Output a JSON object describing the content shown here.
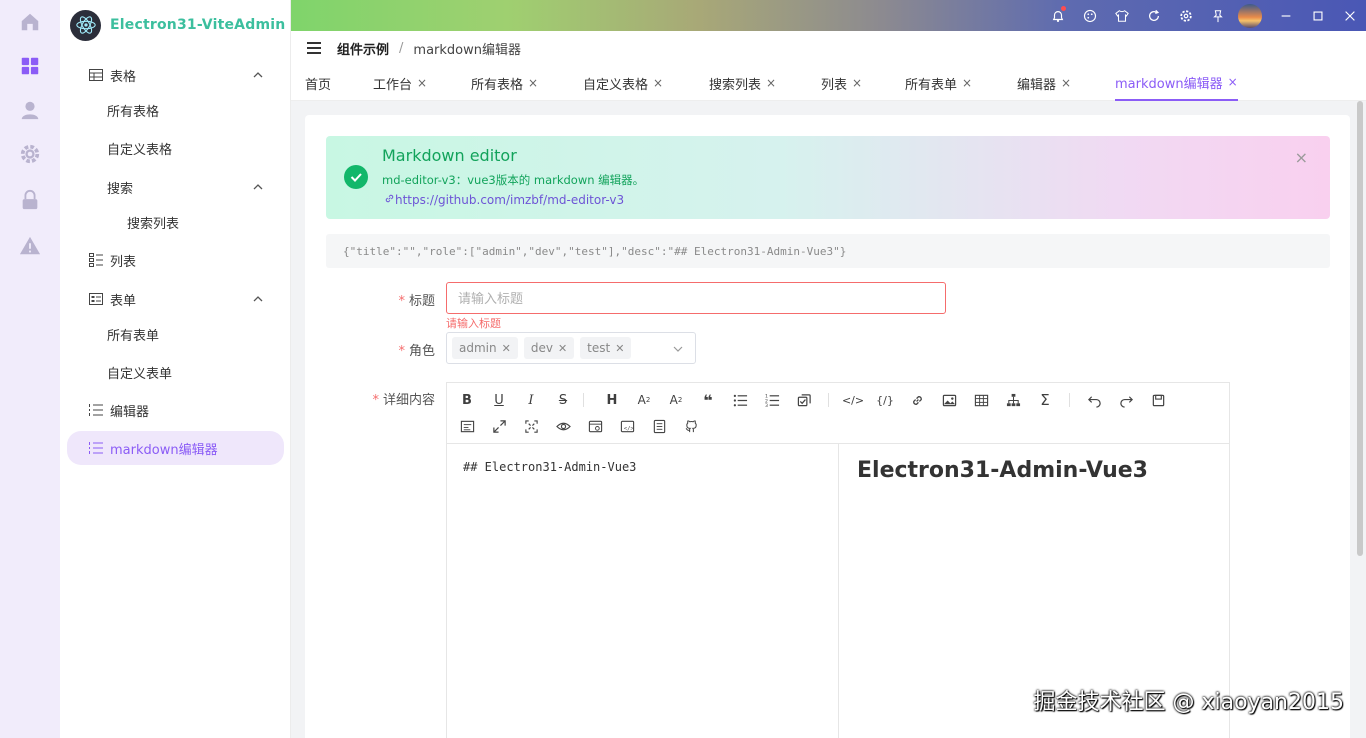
{
  "rail": {
    "items": [
      {
        "icon": "home-icon"
      },
      {
        "icon": "dashboard-grid-icon"
      },
      {
        "icon": "user-icon"
      },
      {
        "icon": "gear-icon"
      },
      {
        "icon": "lock-icon"
      },
      {
        "icon": "warning-icon"
      }
    ]
  },
  "brand": {
    "title": "Electron31-ViteAdmin"
  },
  "sidebar": {
    "items": [
      {
        "label": "表格",
        "icon": "table-icon",
        "expanded": true
      },
      {
        "label": "所有表格"
      },
      {
        "label": "自定义表格"
      },
      {
        "label": "搜索",
        "expanded": true
      },
      {
        "label": "搜索列表"
      },
      {
        "label": "列表",
        "icon": "list-icon"
      },
      {
        "label": "表单",
        "icon": "form-icon",
        "expanded": true
      },
      {
        "label": "所有表单"
      },
      {
        "label": "自定义表单"
      },
      {
        "label": "编辑器",
        "icon": "editor-list-icon"
      },
      {
        "label": "markdown编辑器",
        "icon": "editor-list-icon",
        "active": true
      }
    ]
  },
  "topbar": {
    "icons": [
      "bell-icon",
      "palette-icon",
      "shirt-icon",
      "refresh-icon",
      "settings-icon",
      "pin-icon",
      "avatar",
      "minimize-icon",
      "maximize-icon",
      "close-icon"
    ]
  },
  "breadcrumb": {
    "parent": "组件示例",
    "separator": "/",
    "current": "markdown编辑器"
  },
  "tabs": [
    {
      "label": "首页",
      "closable": false
    },
    {
      "label": "工作台",
      "closable": true
    },
    {
      "label": "所有表格",
      "closable": true
    },
    {
      "label": "自定义表格",
      "closable": true
    },
    {
      "label": "搜索列表",
      "closable": true
    },
    {
      "label": "列表",
      "closable": true
    },
    {
      "label": "所有表单",
      "closable": true
    },
    {
      "label": "编辑器",
      "closable": true
    },
    {
      "label": "markdown编辑器",
      "closable": true,
      "active": true
    }
  ],
  "tab_close_glyph": "×",
  "alert": {
    "title": "Markdown editor",
    "description": "md-editor-v3：vue3版本的 markdown 编辑器。",
    "link": "https://github.com/imzbf/md-editor-v3",
    "close": "×"
  },
  "json_preview": "{\"title\":\"\",\"role\":[\"admin\",\"dev\",\"test\"],\"desc\":\"## Electron31-Admin-Vue3\"}",
  "form": {
    "title_label": "标题",
    "title_placeholder": "请输入标题",
    "title_value": "",
    "title_error": "请输入标题",
    "role_label": "角色",
    "roles": [
      "admin",
      "dev",
      "test"
    ],
    "desc_label": "详细内容",
    "required_mark": "*"
  },
  "editor": {
    "source": "## Electron31-Admin-Vue3",
    "preview_heading": "Electron31-Admin-Vue3",
    "toolbar_row1": [
      "bold-icon",
      "underline-icon",
      "italic-icon",
      "strikethrough-icon",
      "heading-icon",
      "subscript-icon",
      "superscript-icon",
      "quote-icon",
      "unordered-list-icon",
      "ordered-list-icon",
      "task-icon",
      "code-icon",
      "code-block-icon",
      "link-icon",
      "image-icon",
      "table-icon",
      "mermaid-icon",
      "katex-icon",
      "undo-icon",
      "redo-icon",
      "save-icon"
    ],
    "toolbar_row2": [
      "prettier-icon",
      "fullscreen-icon",
      "page-fullscreen-icon",
      "preview-icon",
      "html-preview-icon",
      "catalog-icon",
      "source-icon",
      "github-icon"
    ]
  },
  "colors": {
    "accent": "#8b5cf6",
    "success": "#12a35b",
    "error": "#f56c6c",
    "brand": "#3cbf9e"
  },
  "watermark": "掘金技术社区 @ xiaoyan2015"
}
